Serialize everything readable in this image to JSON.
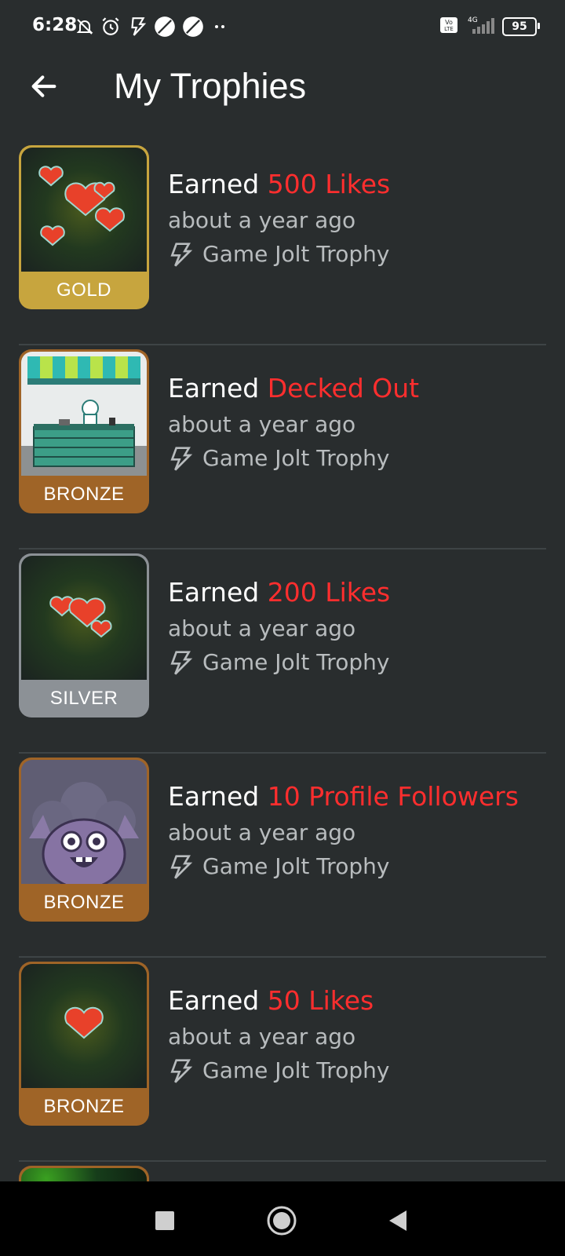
{
  "status_bar": {
    "time": "6:28",
    "battery": "95",
    "network": "4G",
    "volte": "Vo LTE"
  },
  "header": {
    "title": "My Trophies"
  },
  "trophies": [
    {
      "prefix": "Earned",
      "name": "500 Likes",
      "time": "about a year ago",
      "source": "Game Jolt Trophy",
      "tier": "GOLD"
    },
    {
      "prefix": "Earned",
      "name": "Decked Out",
      "time": "about a year ago",
      "source": "Game Jolt Trophy",
      "tier": "BRONZE"
    },
    {
      "prefix": "Earned",
      "name": "200 Likes",
      "time": "about a year ago",
      "source": "Game Jolt Trophy",
      "tier": "SILVER"
    },
    {
      "prefix": "Earned",
      "name": "10 Profile Followers",
      "time": "about a year ago",
      "source": "Game Jolt Trophy",
      "tier": "BRONZE"
    },
    {
      "prefix": "Earned",
      "name": "50 Likes",
      "time": "about a year ago",
      "source": "Game Jolt Trophy",
      "tier": "BRONZE"
    }
  ],
  "colors": {
    "background": "#292d2e",
    "accent_red": "#ff2e2e",
    "gold": "#c7a53e",
    "bronze": "#9f6427",
    "silver": "#8c9196"
  },
  "icons": {
    "back": "arrow-left-icon",
    "source": "gamejolt-bolt-icon",
    "nav_recent": "square-icon",
    "nav_home": "circle-icon",
    "nav_back": "triangle-back-icon"
  }
}
